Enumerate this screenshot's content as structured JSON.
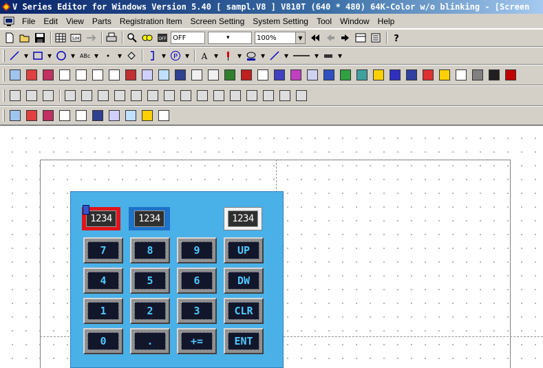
{
  "window": {
    "title": "V Series Editor for Windows Version 5.40 [ sampl.V8 ] V810T (640 * 480) 64K-Color w/o blinking - [Screen"
  },
  "menu": [
    {
      "label": "File",
      "underline": "F",
      "rest": "ile"
    },
    {
      "label": "Edit",
      "underline": "E",
      "rest": "dit"
    },
    {
      "label": "View",
      "underline": "V",
      "rest": "iew"
    },
    {
      "label": "Parts",
      "underline": "P",
      "rest": "arts"
    },
    {
      "label": "Registration Item",
      "underline": "R",
      "rest": "egistration Item"
    },
    {
      "label": "Screen Setting",
      "underline": "",
      "rest": "Screen Setting"
    },
    {
      "label": "System Setting",
      "underline": "",
      "rest": "System Setting"
    },
    {
      "label": "Tool",
      "underline": "T",
      "rest": "ool"
    },
    {
      "label": "Window",
      "underline": "W",
      "rest": "indow"
    },
    {
      "label": "Help",
      "underline": "H",
      "rest": "elp"
    }
  ],
  "toolbar": {
    "state_combo": "OFF",
    "zoom_combo": "100%"
  },
  "keypad": {
    "displays": [
      "1234",
      "1234",
      "1234"
    ],
    "keys": [
      [
        "7",
        "8",
        "9",
        "UP"
      ],
      [
        "4",
        "5",
        "6",
        "DW"
      ],
      [
        "1",
        "2",
        "3",
        "CLR"
      ],
      [
        "0",
        ".",
        "+=",
        "ENT"
      ]
    ]
  },
  "colors": {
    "keypad_bg": "#4ab0e8",
    "key_text": "#4ec8ff",
    "title_bg": "#0a246a"
  }
}
